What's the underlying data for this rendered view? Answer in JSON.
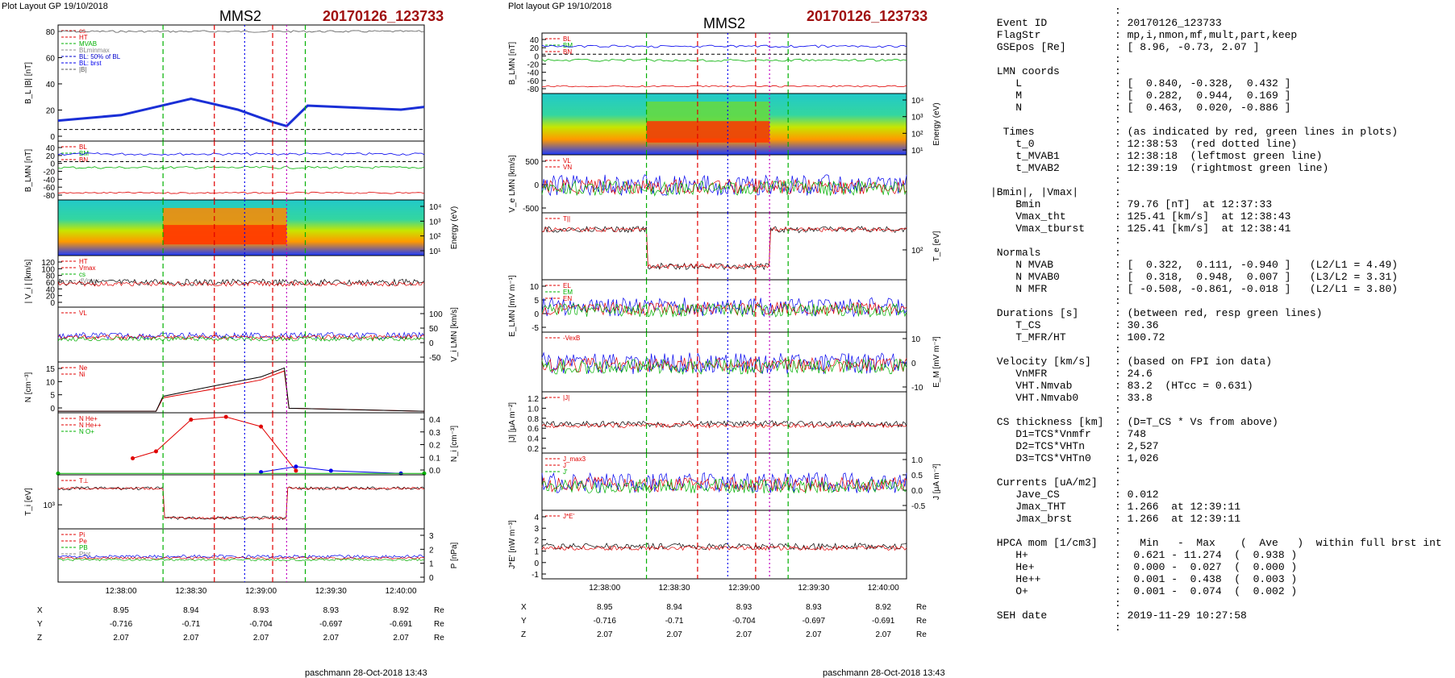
{
  "panels": [
    {
      "header": "Plot Layout GP 19/10/2018",
      "mms": "MMS2",
      "event": "20170126_123733",
      "footer": "paschmann 28-Oct-2018 13:43",
      "time_ticks": [
        "12:38:00",
        "12:38:30",
        "12:39:00",
        "12:39:30",
        "12:40:00"
      ],
      "ephem": [
        {
          "name": "X",
          "vals": [
            "8.95",
            "8.94",
            "8.93",
            "8.93",
            "8.92"
          ],
          "unit": "Re"
        },
        {
          "name": "Y",
          "vals": [
            "-0.716",
            "-0.71",
            "-0.704",
            "-0.697",
            "-0.691"
          ],
          "unit": "Re"
        },
        {
          "name": "Z",
          "vals": [
            "2.07",
            "2.07",
            "2.07",
            "2.07",
            "2.07"
          ],
          "unit": "Re"
        }
      ],
      "subplots": [
        {
          "id": "bl",
          "ylabel": "B_L |B| [nT]",
          "side": "left",
          "ticks": [
            "80",
            "60",
            "40",
            "20",
            "0"
          ],
          "legend": [
            "cs",
            "HT",
            "MVAB",
            "BLminmax",
            "BL: 50% of BL",
            "BL: brst",
            "|B|"
          ]
        },
        {
          "id": "blmn",
          "ylabel": "B_LMN [nT]",
          "side": "left",
          "ticks": [
            "40",
            "20",
            "0",
            "-20",
            "-40",
            "-60",
            "-80"
          ],
          "legend": [
            "BL",
            "BM",
            "BN"
          ]
        },
        {
          "id": "espec",
          "ylabel": "Energy (eV)",
          "side": "right",
          "ticks": [
            "10⁴",
            "10³",
            "10²",
            "10¹"
          ],
          "legend": []
        },
        {
          "id": "vi",
          "ylabel": "| V_i | [km/s]",
          "side": "left",
          "ticks": [
            "120",
            "100",
            "80",
            "60",
            "40",
            "20",
            "0"
          ],
          "legend": [
            "HT",
            "Vmax",
            "cs",
            "dVmax"
          ]
        },
        {
          "id": "vilmn",
          "ylabel": "V_i LMN [km/s]",
          "side": "right",
          "ticks": [
            "100",
            "50",
            "0",
            "-50"
          ],
          "legend": [
            "VL"
          ]
        },
        {
          "id": "n",
          "ylabel": "N [cm⁻³]",
          "side": "left",
          "ticks": [
            "15",
            "10",
            "5",
            "0"
          ],
          "legend": [
            "Ne",
            "Ni"
          ]
        },
        {
          "id": "nhp",
          "ylabel": "N_i [cm⁻³]",
          "side": "right",
          "ticks": [
            "0.4",
            "0.3",
            "0.2",
            "0.1",
            "0.0"
          ],
          "legend": [
            "N He+",
            "N He++",
            "N O+"
          ]
        },
        {
          "id": "ti",
          "ylabel": "T_i [eV]",
          "side": "left",
          "ticks": [
            "10³"
          ],
          "legend": [
            "T⊥"
          ]
        },
        {
          "id": "p",
          "ylabel": "P [nPa]",
          "side": "right",
          "ticks": [
            "3",
            "2",
            "1",
            "0"
          ],
          "legend": [
            "Pi",
            "Pe",
            "PB",
            "Ptot"
          ]
        }
      ]
    },
    {
      "header": "Plot layout GP 19/10/2018",
      "mms": "MMS2",
      "event": "20170126_123733",
      "footer": "paschmann 28-Oct-2018 13:43",
      "time_ticks": [
        "12:38:00",
        "12:38:30",
        "12:39:00",
        "12:39:30",
        "12:40:00"
      ],
      "ephem": [
        {
          "name": "X",
          "vals": [
            "8.95",
            "8.94",
            "8.93",
            "8.93",
            "8.92"
          ],
          "unit": "Re"
        },
        {
          "name": "Y",
          "vals": [
            "-0.716",
            "-0.71",
            "-0.704",
            "-0.697",
            "-0.691"
          ],
          "unit": "Re"
        },
        {
          "name": "Z",
          "vals": [
            "2.07",
            "2.07",
            "2.07",
            "2.07",
            "2.07"
          ],
          "unit": "Re"
        }
      ],
      "subplots": [
        {
          "id": "blmn2",
          "ylabel": "B_LMN [nT]",
          "side": "left",
          "ticks": [
            "40",
            "20",
            "0",
            "-20",
            "-40",
            "-60",
            "-80"
          ],
          "legend": [
            "BL",
            "BM",
            "BN"
          ]
        },
        {
          "id": "espec2",
          "ylabel": "Energy (eV)",
          "side": "right",
          "ticks": [
            "10⁴",
            "10³",
            "10²",
            "10¹"
          ],
          "legend": []
        },
        {
          "id": "ve",
          "ylabel": "V_e LMN [km/s]",
          "side": "left",
          "ticks": [
            "500",
            "0",
            "-500"
          ],
          "legend": [
            "VL",
            "VN"
          ]
        },
        {
          "id": "te",
          "ylabel": "T_e [eV]",
          "side": "right",
          "ticks": [
            "10²"
          ],
          "legend": [
            "T||"
          ]
        },
        {
          "id": "elmn",
          "ylabel": "E_LMN [mV m⁻¹]",
          "side": "left",
          "ticks": [
            "10",
            "5",
            "0",
            "-5"
          ],
          "legend": [
            "EL",
            "EM",
            "EN"
          ]
        },
        {
          "id": "em",
          "ylabel": "E_M [mV m⁻²]",
          "side": "right",
          "ticks": [
            "10",
            "0",
            "-10"
          ],
          "legend": [
            "-VexB"
          ]
        },
        {
          "id": "jmag",
          "ylabel": "|J| [μA m⁻²]",
          "side": "left",
          "ticks": [
            "1.2",
            "1.0",
            "0.8",
            "0.6",
            "0.4",
            "0.2"
          ],
          "legend": [
            "|J|"
          ]
        },
        {
          "id": "jlmn",
          "ylabel": "J [μA m⁻²]",
          "side": "right",
          "ticks": [
            "1.0",
            "0.5",
            "0.0",
            "-0.5"
          ],
          "legend": [
            "J_max3",
            "J",
            "J'"
          ]
        },
        {
          "id": "je",
          "ylabel": "J*E' [nW m⁻³]",
          "side": "left",
          "ticks": [
            "4",
            "3",
            "2",
            "1",
            "0",
            "-1"
          ],
          "legend": [
            "J*E'"
          ]
        }
      ]
    }
  ],
  "chart_data": [
    {
      "type": "line",
      "title": "MMS2",
      "xlabel": "",
      "x_ticks": [
        "12:38:00",
        "12:38:30",
        "12:39:00",
        "12:39:30",
        "12:40:00"
      ],
      "series": [
        {
          "name": "|B|",
          "x": [
            "12:37:33",
            "12:38:00",
            "12:38:20",
            "12:38:30",
            "12:38:50",
            "12:39:05",
            "12:39:11",
            "12:39:20",
            "12:40:00",
            "12:40:10"
          ],
          "values": [
            15,
            19,
            27,
            31,
            23,
            14,
            11,
            26,
            23,
            25
          ]
        }
      ]
    },
    {
      "type": "line",
      "title": "",
      "ylabel": "N [cm⁻³]",
      "series": [
        {
          "name": "Ne",
          "x": [
            "12:37:33",
            "12:38:15",
            "12:38:18",
            "12:38:40",
            "12:39:00",
            "12:39:10",
            "12:39:12",
            "12:40:10"
          ],
          "values": [
            0.5,
            0.5,
            5,
            8,
            11,
            14,
            1.5,
            0.5
          ]
        },
        {
          "name": "Ni",
          "x": [
            "12:37:33",
            "12:38:15",
            "12:38:18",
            "12:38:40",
            "12:39:00",
            "12:39:10",
            "12:39:12",
            "12:40:10"
          ],
          "values": [
            0.5,
            0.5,
            5.5,
            9,
            12,
            15,
            1.5,
            0.5
          ]
        }
      ],
      "ylim": [
        0,
        17
      ]
    },
    {
      "type": "line",
      "title": "",
      "ylabel": "N_i [cm⁻³]",
      "series": [
        {
          "name": "N He++",
          "x": [
            "12:38:05",
            "12:38:15",
            "12:38:30",
            "12:38:45",
            "12:39:00",
            "12:39:15"
          ],
          "values": [
            0.12,
            0.17,
            0.4,
            0.42,
            0.35,
            0.03
          ]
        },
        {
          "name": "N O+",
          "x": [
            "12:39:00",
            "12:39:15",
            "12:39:30",
            "12:40:00"
          ],
          "values": [
            0.02,
            0.06,
            0.03,
            0.01
          ]
        },
        {
          "name": "N He+",
          "x": [
            "12:37:33",
            "12:40:10"
          ],
          "values": [
            0.01,
            0.01
          ]
        }
      ],
      "ylim": [
        0,
        0.45
      ]
    }
  ],
  "event_info": [
    {
      "label": "",
      "value": ":"
    },
    {
      "label": " Event ID",
      "value": ": 20170126_123733"
    },
    {
      "label": " FlagStr",
      "value": ": mp,i,nmon,mf,mult,part,keep"
    },
    {
      "label": " GSEpos [Re]",
      "value": ": [ 8.96, -0.73, 2.07 ]"
    },
    {
      "label": "",
      "value": ":"
    },
    {
      "label": " LMN coords",
      "value": ":"
    },
    {
      "label": "    L",
      "value": ": [  0.840, -0.328,  0.432 ]"
    },
    {
      "label": "    M",
      "value": ": [  0.282,  0.944,  0.169 ]"
    },
    {
      "label": "    N",
      "value": ": [  0.463,  0.020, -0.886 ]"
    },
    {
      "label": "",
      "value": ":"
    },
    {
      "label": "  Times",
      "value": ": (as indicated by red, green lines in plots)"
    },
    {
      "label": "    t_0",
      "value": ": 12:38:53  (red dotted line)"
    },
    {
      "label": "    t_MVAB1",
      "value": ": 12:38:18  (leftmost green line)"
    },
    {
      "label": "    t_MVAB2",
      "value": ": 12:39:19  (rightmost green line)"
    },
    {
      "label": "",
      "value": ":"
    },
    {
      "label": "|Bmin|, |Vmax|",
      "value": ":"
    },
    {
      "label": "    Bmin",
      "value": ": 79.76 [nT]  at 12:37:33"
    },
    {
      "label": "    Vmax_tht",
      "value": ": 125.41 [km/s]  at 12:38:43"
    },
    {
      "label": "    Vmax_tburst",
      "value": ": 125.41 [km/s]  at 12:38:41"
    },
    {
      "label": "",
      "value": ":"
    },
    {
      "label": " Normals",
      "value": ":"
    },
    {
      "label": "    N MVAB",
      "value": ": [  0.322,  0.111, -0.940 ]   (L2/L1 = 4.49)"
    },
    {
      "label": "    N MVAB0",
      "value": ": [  0.318,  0.948,  0.007 ]   (L3/L2 = 3.31)"
    },
    {
      "label": "    N MFR",
      "value": ": [ -0.508, -0.861, -0.018 ]   (L2/L1 = 3.80)"
    },
    {
      "label": "",
      "value": ":"
    },
    {
      "label": " Durations [s]",
      "value": ": (between red, resp green lines)"
    },
    {
      "label": "    T_CS",
      "value": ": 30.36"
    },
    {
      "label": "    T_MFR/HT",
      "value": ": 100.72"
    },
    {
      "label": "",
      "value": ":"
    },
    {
      "label": " Velocity [km/s]",
      "value": ": (based on FPI ion data)"
    },
    {
      "label": "    VnMFR",
      "value": ": 24.6"
    },
    {
      "label": "    VHT.Nmvab",
      "value": ": 83.2  (HTcc = 0.631)"
    },
    {
      "label": "    VHT.Nmvab0",
      "value": ": 33.8"
    },
    {
      "label": "",
      "value": ":"
    },
    {
      "label": " CS thickness [km]",
      "value": ": (D=T_CS * Vs from above)"
    },
    {
      "label": "    D1=TCS*Vnmfr",
      "value": ": 748"
    },
    {
      "label": "    D2=TCS*VHTn",
      "value": ": 2,527"
    },
    {
      "label": "    D3=TCS*VHTn0",
      "value": ": 1,026"
    },
    {
      "label": "",
      "value": ":"
    },
    {
      "label": " Currents [uA/m2]",
      "value": ":"
    },
    {
      "label": "    Jave_CS",
      "value": ": 0.012"
    },
    {
      "label": "    Jmax_THT",
      "value": ": 1.266  at 12:39:11"
    },
    {
      "label": "    Jmax_brst",
      "value": ": 1.266  at 12:39:11"
    },
    {
      "label": "",
      "value": ":"
    },
    {
      "label": " HPCA mom [1/cm3]",
      "value": ":   Min   -  Max    (  Ave   )  within full brst int"
    },
    {
      "label": "    H+",
      "value": ":  0.621 - 11.274  (  0.938 )"
    },
    {
      "label": "    He+",
      "value": ":  0.000 -  0.027  (  0.000 )"
    },
    {
      "label": "    He++",
      "value": ":  0.001 -  0.438  (  0.003 )"
    },
    {
      "label": "    O+",
      "value": ":  0.001 -  0.074  (  0.002 )"
    },
    {
      "label": "",
      "value": ":"
    },
    {
      "label": " SEH date",
      "value": ": 2019-11-29 10:27:58"
    },
    {
      "label": "",
      "value": ":"
    }
  ],
  "colors": {
    "red": "#e00000",
    "green": "#00b000",
    "blue": "#0000ee",
    "title_red": "#a01010",
    "black": "#000000"
  }
}
